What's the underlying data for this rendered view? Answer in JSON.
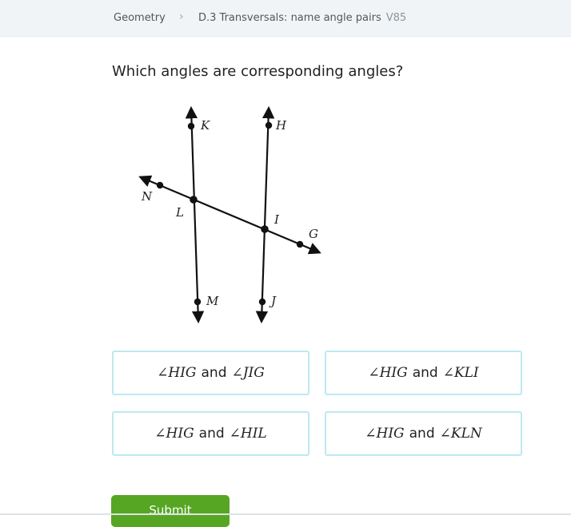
{
  "breadcrumb": {
    "subject": "Geometry",
    "skill": "D.3 Transversals: name angle pairs",
    "code": "V85"
  },
  "question": "Which angles are corresponding angles?",
  "diagram": {
    "labels": {
      "K": "K",
      "H": "H",
      "N": "N",
      "L": "L",
      "I": "I",
      "G": "G",
      "M": "M",
      "J": "J"
    }
  },
  "choices": [
    {
      "a": "∠HIG",
      "conj": "and",
      "b": "∠JIG"
    },
    {
      "a": "∠HIG",
      "conj": "and",
      "b": "∠KLI"
    },
    {
      "a": "∠HIG",
      "conj": "and",
      "b": "∠HIL"
    },
    {
      "a": "∠HIG",
      "conj": "and",
      "b": "∠KLN"
    }
  ],
  "submit_label": "Submit",
  "colors": {
    "accent_border": "#bce9f0",
    "submit_green": "#56a623"
  }
}
